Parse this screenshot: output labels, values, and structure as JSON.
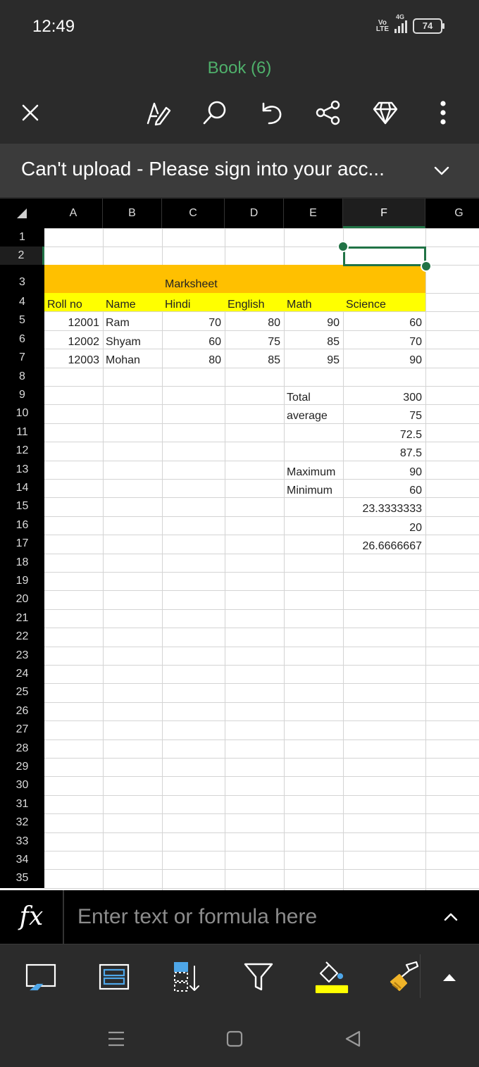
{
  "status_bar": {
    "time": "12:49",
    "volte": "Vo LTE",
    "network": "4G",
    "battery": "74"
  },
  "app": {
    "title": "Book (6)"
  },
  "toolbar": {
    "icons": [
      "close-icon",
      "draw-icon",
      "search-icon",
      "undo-icon",
      "share-icon",
      "premium-icon",
      "more-icon"
    ]
  },
  "banner": {
    "message": "Can't upload - Please sign into your acc..."
  },
  "sheet": {
    "columns": [
      "A",
      "B",
      "C",
      "D",
      "E",
      "F",
      "G"
    ],
    "selected_column": "F",
    "selected_row": "2",
    "rows": [
      "1",
      "2",
      "3",
      "4",
      "5",
      "6",
      "7",
      "8",
      "9",
      "10",
      "11",
      "12",
      "13",
      "14",
      "15",
      "16",
      "17",
      "18",
      "19",
      "20",
      "21",
      "22",
      "23",
      "24",
      "25",
      "26",
      "27",
      "28",
      "29",
      "30",
      "31",
      "32",
      "33",
      "34",
      "35"
    ],
    "title_cell": "Marksheet",
    "headers": [
      "Roll no",
      "Name",
      "Hindi",
      "English",
      "Math",
      "Science"
    ],
    "data_rows": [
      [
        "12001",
        "Ram",
        "70",
        "80",
        "90",
        "60"
      ],
      [
        "12002",
        "Shyam",
        "60",
        "75",
        "85",
        "70"
      ],
      [
        "12003",
        "Mohan",
        "80",
        "85",
        "95",
        "90"
      ]
    ],
    "summary": [
      {
        "row": "9",
        "label": "Total",
        "value": "300"
      },
      {
        "row": "10",
        "label": "average",
        "value": "75"
      },
      {
        "row": "11",
        "label": "",
        "value": "72.5"
      },
      {
        "row": "12",
        "label": "",
        "value": "87.5"
      },
      {
        "row": "13",
        "label": "Maximum",
        "value": "90"
      },
      {
        "row": "14",
        "label": "Minimum",
        "value": "60"
      },
      {
        "row": "15",
        "label": "",
        "value": "23.3333333"
      },
      {
        "row": "16",
        "label": "",
        "value": "20"
      },
      {
        "row": "17",
        "label": "",
        "value": "26.6666667"
      }
    ],
    "colors": {
      "title_fill": "#FFC000",
      "header_fill": "#FFFF00",
      "selection": "#217346"
    }
  },
  "formula_bar": {
    "fx": "fx",
    "placeholder": "Enter text or formula here"
  },
  "bottom_toolbar": {
    "icons": [
      "select-icon",
      "freeze-panes-icon",
      "sort-icon",
      "filter-icon",
      "fill-color-icon",
      "format-painter-icon",
      "expand-icon"
    ],
    "fill_color": "#FFFF00"
  },
  "nav_bar": {
    "icons": [
      "recent-apps-icon",
      "home-icon",
      "back-icon"
    ]
  }
}
